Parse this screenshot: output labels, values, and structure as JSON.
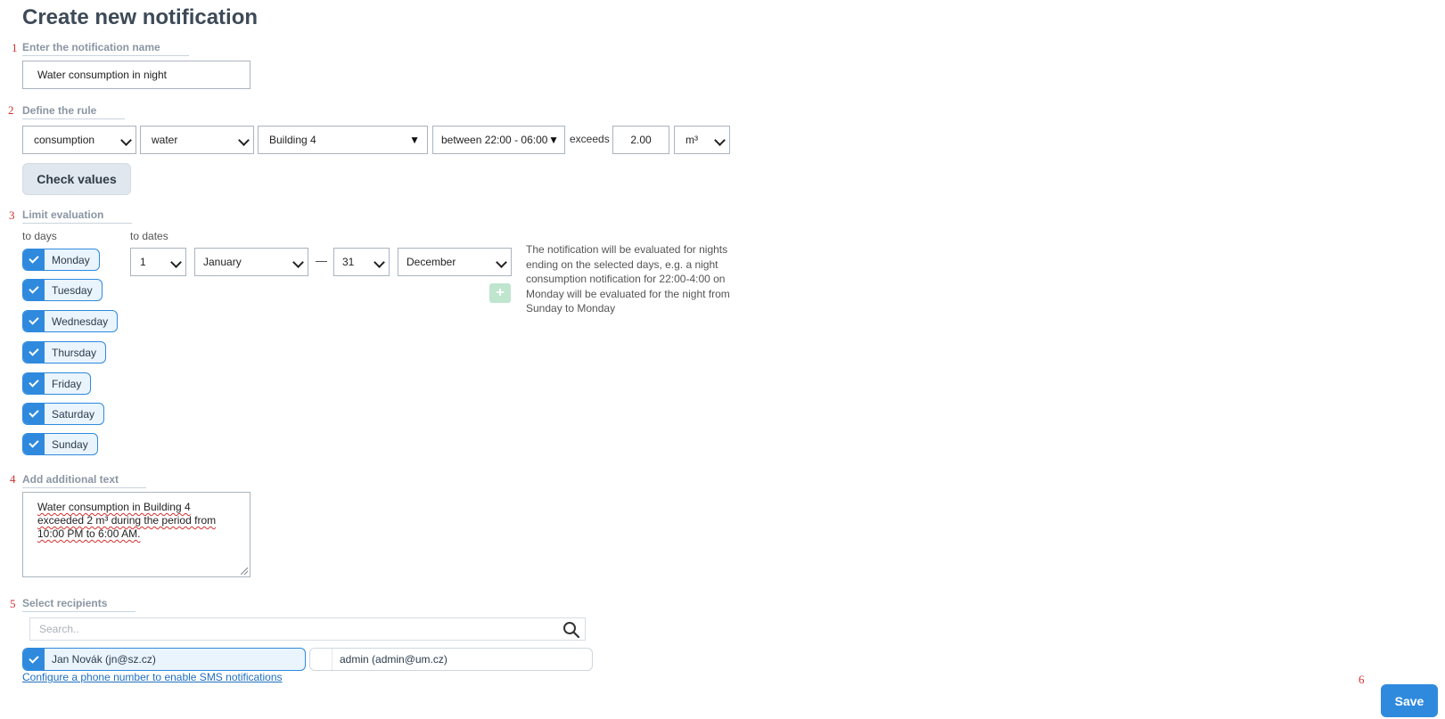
{
  "page": {
    "title": "Create new notification"
  },
  "steps": {
    "s1": "1",
    "s2": "2",
    "s3": "3",
    "s4": "4",
    "s5": "5",
    "s6": "6"
  },
  "name_section": {
    "label": "Enter the notification name",
    "value": "Water consumption in night"
  },
  "rule": {
    "label": "Define the rule",
    "metric": "consumption",
    "medium": "water",
    "building": "Building 4",
    "period": "between 22:00 - 06:00",
    "exceeds_label": "exceeds",
    "threshold": "2.00",
    "unit": "m³",
    "check_button": "Check values"
  },
  "limit": {
    "label": "Limit evaluation",
    "days_label": "to days",
    "dates_label": "to dates",
    "days": [
      "Monday",
      "Tuesday",
      "Wednesday",
      "Thursday",
      "Friday",
      "Saturday",
      "Sunday"
    ],
    "days_checked": [
      true,
      true,
      true,
      true,
      true,
      true,
      true
    ],
    "from_day": "1",
    "from_month": "January",
    "dash": "—",
    "to_day": "31",
    "to_month": "December",
    "add_icon": "plus-icon",
    "note": "The notification will be evaluated for nights ending on the selected days, e.g. a night consumption notification for 22:00-4:00 on Monday will be evaluated for the night from Sunday to Monday"
  },
  "additional_text": {
    "label": "Add additional text",
    "value": "Water consumption in Building 4 exceeded 2 m³ during the period from 10:00 PM to 6:00 AM."
  },
  "recipients": {
    "label": "Select recipients",
    "search_placeholder": "Search..",
    "items": [
      {
        "name": "Jan Novák (jn@sz.cz)",
        "checked": true
      },
      {
        "name": "admin (admin@um.cz)",
        "checked": false
      }
    ],
    "sms_link": "Configure a phone number to enable SMS notifications"
  },
  "actions": {
    "save": "Save"
  },
  "colors": {
    "accent": "#2f8ade",
    "step_number": "#d32f2f",
    "label": "#8a96a3"
  }
}
